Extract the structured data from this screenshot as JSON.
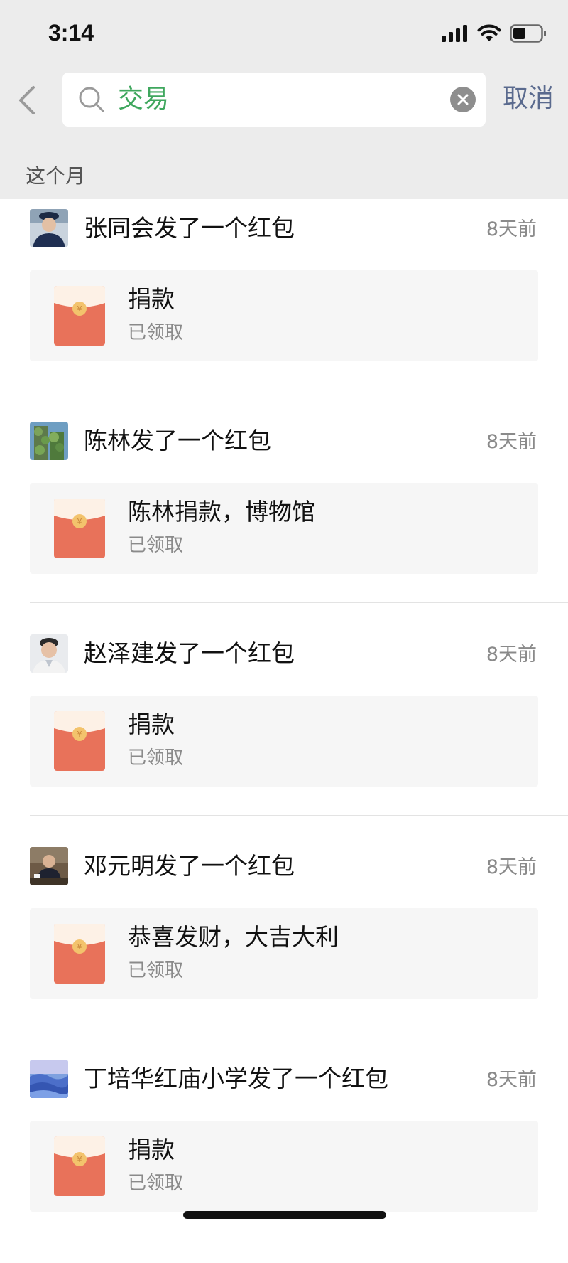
{
  "status_bar": {
    "time": "3:14"
  },
  "search": {
    "query": "交易",
    "cancel_label": "取消"
  },
  "section": {
    "label": "这个月"
  },
  "items": [
    {
      "title": "张同会发了一个红包",
      "time": "8天前",
      "card_title": "捐款",
      "card_status": "已领取",
      "avatar": "person-portrait"
    },
    {
      "title": "陈林发了一个红包",
      "time": "8天前",
      "card_title": "陈林捐款，博物馆",
      "card_status": "已领取",
      "avatar": "green-building"
    },
    {
      "title": "赵泽建发了一个红包",
      "time": "8天前",
      "card_title": "捐款",
      "card_status": "已领取",
      "avatar": "person-portrait"
    },
    {
      "title": "邓元明发了一个红包",
      "time": "8天前",
      "card_title": "恭喜发财，大吉大利",
      "card_status": "已领取",
      "avatar": "person-at-desk"
    },
    {
      "title": "丁培华红庙小学发了一个红包",
      "time": "8天前",
      "card_title": "捐款",
      "card_status": "已领取",
      "avatar": "blue-dunes"
    }
  ],
  "colors": {
    "search_text": "#3fa75e",
    "cancel": "#5a6a8e",
    "envelope_red": "#e8725a",
    "envelope_flap": "#fdf1e6",
    "envelope_seal": "#f3c36c"
  }
}
